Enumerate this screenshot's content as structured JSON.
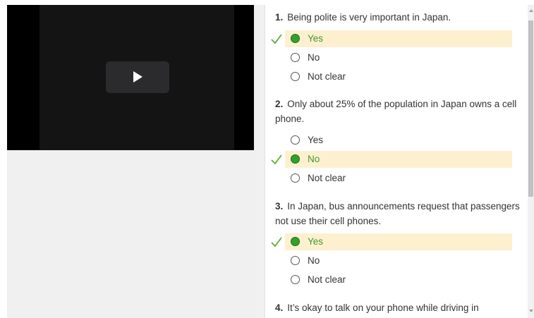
{
  "video": {
    "play_icon": "play-icon"
  },
  "questions": [
    {
      "number": "1.",
      "text": "Being polite is very important in Japan.",
      "options": [
        "Yes",
        "No",
        "Not clear"
      ],
      "selected": "Yes"
    },
    {
      "number": "2.",
      "text": "Only about 25% of the population in Japan owns a cell phone.",
      "options": [
        "Yes",
        "No",
        "Not clear"
      ],
      "selected": "No"
    },
    {
      "number": "3.",
      "text": "In Japan, bus announcements request that passengers not use their cell phones.",
      "options": [
        "Yes",
        "No",
        "Not clear"
      ],
      "selected": "Yes"
    },
    {
      "number": "4.",
      "text": "It’s okay to talk on your phone while driving in",
      "options": [],
      "selected": ""
    }
  ],
  "colors": {
    "selected_bg": "#fdf0cf",
    "selected_text": "#3e9a2c",
    "radio_selected": "#33a02c",
    "check": "#5cae33"
  }
}
